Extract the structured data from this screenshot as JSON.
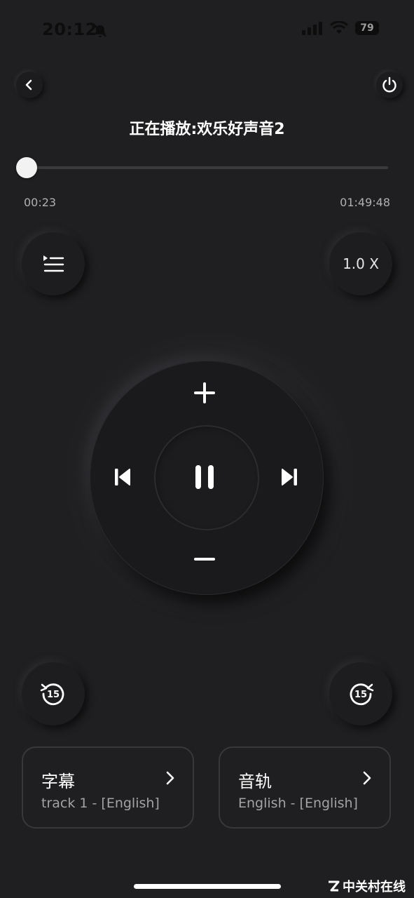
{
  "status_bar": {
    "time": "20:12",
    "battery": "79"
  },
  "header": {
    "title": "正在播放:欢乐好声音2"
  },
  "progress": {
    "current": "00:23",
    "total": "01:49:48",
    "fraction": 0.003
  },
  "controls": {
    "speed": "1.0 X",
    "rewind_seconds": "15",
    "forward_seconds": "15"
  },
  "cards": {
    "subtitle": {
      "title": "字幕",
      "value": "track 1 - [English]"
    },
    "audio": {
      "title": "音轨",
      "value": "English - [English]"
    }
  },
  "watermark": {
    "text": "中关村在线"
  },
  "colors": {
    "background": "#1f1f21",
    "text": "#ffffff",
    "muted": "#a3a3a6"
  }
}
